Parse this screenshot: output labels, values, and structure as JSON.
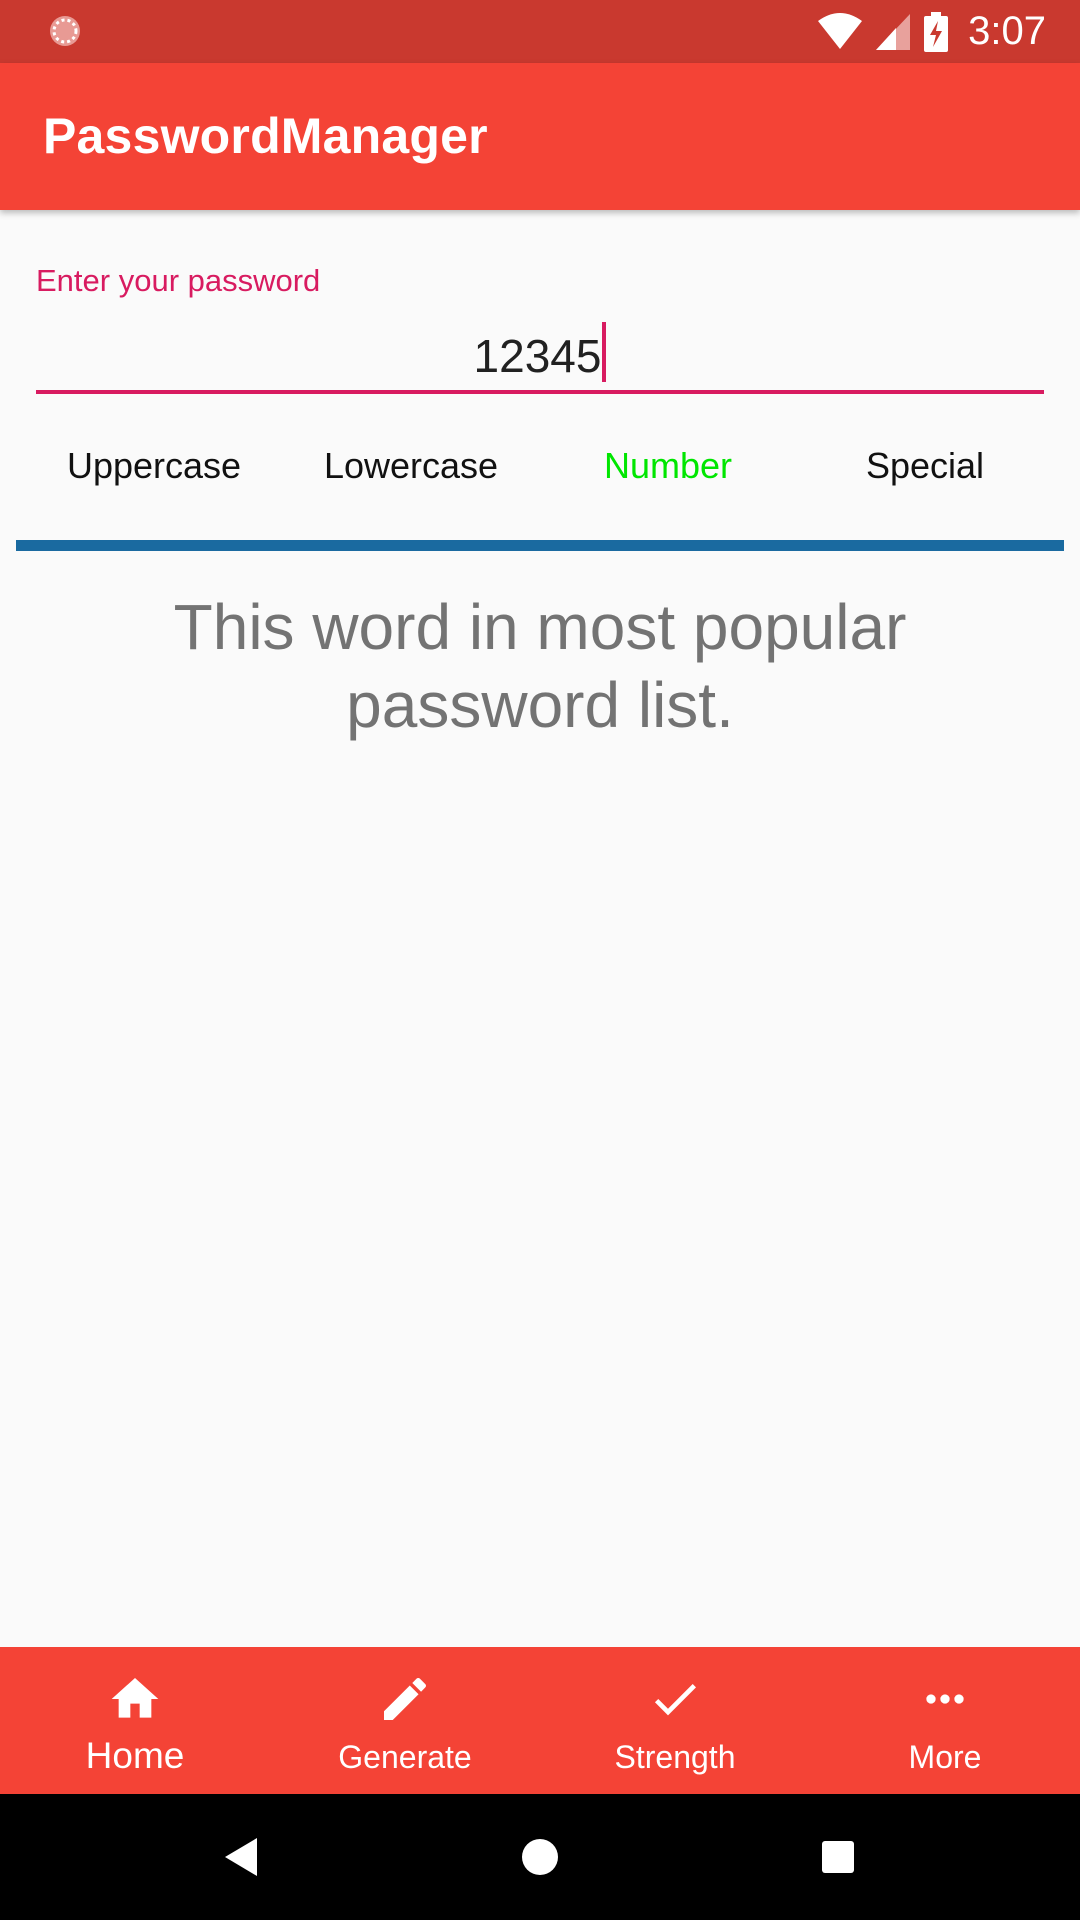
{
  "status_bar": {
    "time": "3:07",
    "icons": [
      "activity-indicator-icon",
      "wifi-icon",
      "signal-icon",
      "battery-charging-icon"
    ],
    "background": "#c9392f"
  },
  "app_bar": {
    "title": "PasswordManager",
    "background": "#f44336"
  },
  "password_field": {
    "label": "Enter your password",
    "value": "12345",
    "accent_color": "#d81b60"
  },
  "criteria": [
    {
      "label": "Uppercase",
      "met": false
    },
    {
      "label": "Lowercase",
      "met": false
    },
    {
      "label": "Number",
      "met": true
    },
    {
      "label": "Special",
      "met": false
    }
  ],
  "criteria_colors": {
    "met": "#00e600",
    "unmet": "#111111"
  },
  "strength_bar_color": "#1a6aa0",
  "message": "This word in most popular password list.",
  "bottom_nav": {
    "items": [
      {
        "label": "Home",
        "icon": "home-icon",
        "active": true
      },
      {
        "label": "Generate",
        "icon": "pencil-icon",
        "active": false
      },
      {
        "label": "Strength",
        "icon": "check-icon",
        "active": false
      },
      {
        "label": "More",
        "icon": "more-horizontal-icon",
        "active": false
      }
    ]
  },
  "system_nav": {
    "icons": [
      "back-icon",
      "home-circle-icon",
      "recents-icon"
    ]
  }
}
